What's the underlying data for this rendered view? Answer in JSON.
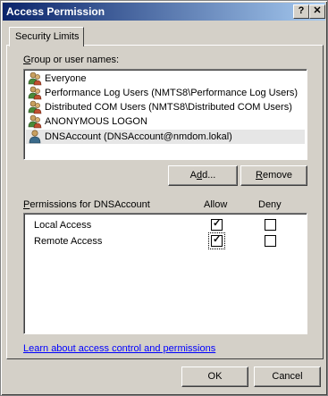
{
  "window": {
    "title": "Access Permission",
    "help_label": "?",
    "close_label": "✕"
  },
  "tabs": [
    {
      "label": "Security Limits"
    }
  ],
  "groups": {
    "label_pre": "",
    "label_accel": "G",
    "label_post": "roup or user names:",
    "items": [
      {
        "label": "Everyone",
        "icon": "group-icon"
      },
      {
        "label": "Performance Log Users (NMTS8\\Performance Log Users)",
        "icon": "group-icon"
      },
      {
        "label": "Distributed COM Users (NMTS8\\Distributed COM Users)",
        "icon": "group-icon"
      },
      {
        "label": "ANONYMOUS LOGON",
        "icon": "group-icon"
      },
      {
        "label": "DNSAccount (DNSAccount@nmdom.lokal)",
        "icon": "user-icon"
      }
    ]
  },
  "buttons": {
    "add_pre": "A",
    "add_accel": "d",
    "add_post": "d...",
    "remove_pre": "",
    "remove_accel": "R",
    "remove_post": "emove",
    "ok": "OK",
    "cancel": "Cancel"
  },
  "permissions": {
    "label_pre": "",
    "label_accel": "P",
    "label_post": "ermissions for DNSAccount",
    "allow_header": "Allow",
    "deny_header": "Deny",
    "rows": [
      {
        "label": "Local Access",
        "allow": true,
        "deny": false
      },
      {
        "label": "Remote Access",
        "allow": true,
        "deny": false
      }
    ]
  },
  "link": {
    "label": "Learn about access control and permissions"
  },
  "colors": {
    "face": "#d4d0c8",
    "title_start": "#0a246a",
    "title_end": "#a6caf0",
    "link": "#0000ff"
  }
}
